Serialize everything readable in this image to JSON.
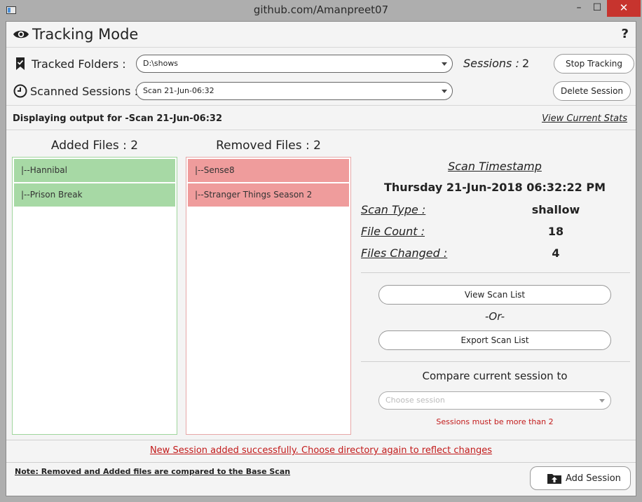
{
  "window": {
    "title": "github.com/Amanpreet07",
    "controls": {
      "minimize": "–",
      "maximize": "☐",
      "close": "✕"
    }
  },
  "header": {
    "title": "Tracking Mode",
    "help": "?"
  },
  "tracked": {
    "label": "Tracked Folders :",
    "value": "D:\\shows",
    "sessions_label": "Sessions :",
    "sessions_count": "2",
    "stop_button": "Stop Tracking"
  },
  "scanned": {
    "label": "Scanned Sessions :",
    "value": "Scan 21-Jun-06:32",
    "delete_button": "Delete Session"
  },
  "output": {
    "text": "Displaying output for -Scan 21-Jun-06:32",
    "view_stats": "View Current Stats"
  },
  "added": {
    "heading": "Added Files : 2",
    "items": [
      "|--Hannibal",
      "|--Prison Break"
    ]
  },
  "removed": {
    "heading": "Removed Files : 2",
    "items": [
      "|--Sense8",
      "|--Stranger Things Season 2"
    ]
  },
  "stats": {
    "title": "Scan Timestamp",
    "timestamp": "Thursday 21-Jun-2018 06:32:22 PM",
    "rows": [
      {
        "key": "Scan Type :",
        "value": "shallow"
      },
      {
        "key": "File Count :",
        "value": "18"
      },
      {
        "key": "Files Changed :",
        "value": "4"
      }
    ],
    "view_scan_list": "View Scan List",
    "or": "-Or-",
    "export_scan_list": "Export Scan List",
    "compare_label": "Compare current session to",
    "choose_placeholder": "Choose session",
    "warning": "Sessions must be more than 2"
  },
  "footer": {
    "success": "New Session added successfully. Choose directory again to reflect changes",
    "note": "Note: Removed and Added files are compared to the Base Scan",
    "add_session": "Add Session"
  },
  "colors": {
    "added_fill": "#a7d9a5",
    "removed_fill": "#ef9c9c",
    "warning": "#c21a1a",
    "close_button": "#c7342e"
  }
}
